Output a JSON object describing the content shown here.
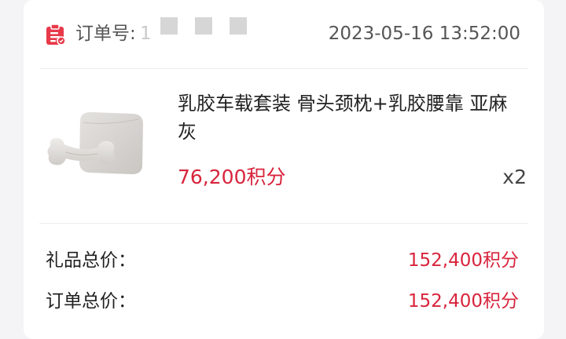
{
  "order": {
    "label": "订单号:",
    "number_visible": "1",
    "time": "2023-05-16 13:52:00",
    "icon": "clipboard-icon",
    "icon_color": "#e8394a"
  },
  "product": {
    "name": "乳胶车载套装 骨头颈枕+乳胶腰靠 亚麻灰",
    "price": "76,200积分",
    "quantity": "x2",
    "image": "latex-car-pillow-set-image"
  },
  "summary": {
    "gift_total_label": "礼品总价：",
    "gift_total_value": "152,400积分",
    "order_total_label": "订单总价：",
    "order_total_value": "152,400积分"
  },
  "colors": {
    "accent_red": "#d8243c",
    "text_dark": "#222222",
    "text_gray": "#555555",
    "background": "#f4f4f6",
    "card": "#ffffff"
  }
}
